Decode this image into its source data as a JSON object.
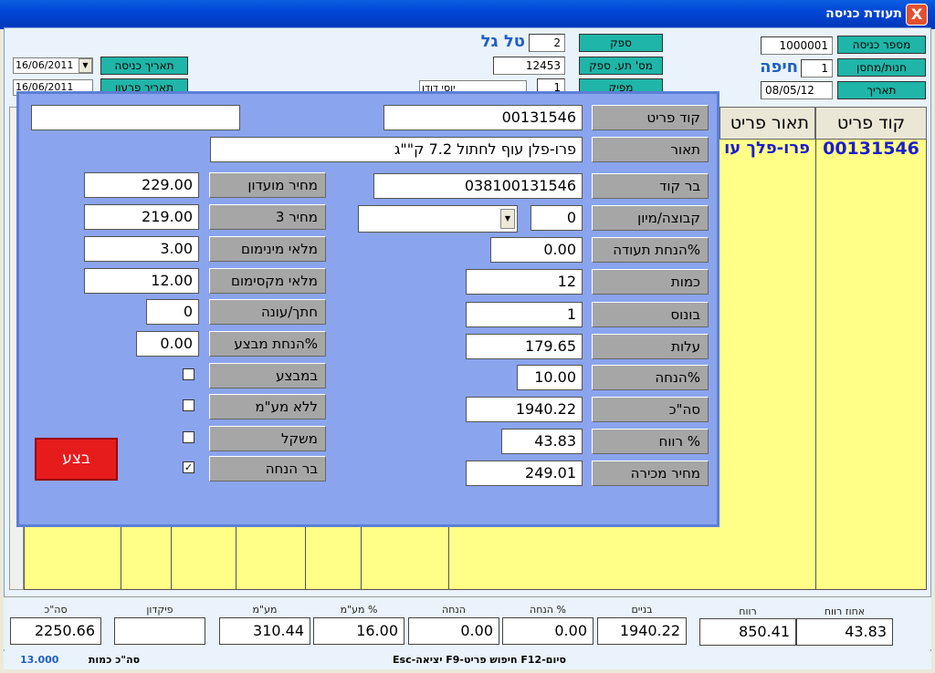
{
  "window": {
    "title": "תעודת כניסה",
    "close_glyph": "X"
  },
  "header": {
    "entry_number_label": "מספר כניסה",
    "entry_number": "1000001",
    "store_label": "חנות/מחסן",
    "store_code": "1",
    "store_name": "חיפה",
    "date_label": "תאריך",
    "date": "08/05/12",
    "supplier_label": "ספק",
    "supplier_code": "2",
    "supplier_name": "טל גל",
    "supplier_doc_label": "מס' תע. ספק",
    "supplier_doc": "12453",
    "dist_label": "מפיק",
    "dist_code": "1",
    "dist_name": "יוסי דודו",
    "entry_date_label": "תאריך כניסה",
    "entry_date": "16/06/2011",
    "pay_date_label": "תאריך פרעון",
    "pay_date": "16/06/2011"
  },
  "grid": {
    "col_code": "קוד פריט",
    "col_desc": "תאור פריט",
    "row_code": "00131546",
    "row_desc": "פרו-פלך עו"
  },
  "dialog": {
    "item_code_label": "קוד פריט",
    "item_code": "00131546",
    "extra_field": "",
    "desc_label": "תאור",
    "desc": "פרו-פלן עוף לחתול 7.2 ק\"\"ג",
    "barcode_label": "בר קוד",
    "barcode": "038100131546",
    "group_label": "קבוצה/מיון",
    "group": "0",
    "group_select": "",
    "doc_discount_label": "%הנחת תעודה",
    "doc_discount": "0.00",
    "qty_label": "כמות",
    "qty": "12",
    "bonus_label": "בונוס",
    "bonus": "1",
    "cost_label": "עלות",
    "cost": "179.65",
    "discount_label": "%הנחה",
    "discount": "10.00",
    "total_label": "סה\"כ",
    "total": "1940.22",
    "profit_label": "% רווח",
    "profit": "43.83",
    "sale_price_label": "מחיר מכירה",
    "sale_price": "249.01",
    "club_price_label": "מחיר מועדון",
    "club_price": "229.00",
    "price3_label": "מחיר 3",
    "price3": "219.00",
    "min_stock_label": "מלאי מינימום",
    "min_stock": "3.00",
    "max_stock_label": "מלאי מקסימום",
    "max_stock": "12.00",
    "size_label": "חתך/עונה",
    "size": "0",
    "promo_discount_label": "%הנחת מבצע",
    "promo_discount": "0.00",
    "on_sale_label": "במבצע",
    "no_vat_label": "ללא מע\"מ",
    "weight_label": "משקל",
    "bar_discount_label": "בר הנחה",
    "exec_label": "בצע",
    "check": "✓",
    "dd": "▼"
  },
  "footer": {
    "profit_pct_label": "אחוז רווח",
    "profit_pct": "43.83",
    "profit_label": "רווח",
    "profit": "850.41",
    "net_label": "בניים",
    "net": "1940.22",
    "disc_pct_label": "% הנחה",
    "disc_pct": "0.00",
    "disc_label": "הנחה",
    "disc": "0.00",
    "vat_pct_label": "% מע\"מ",
    "vat_pct": "16.00",
    "vat_label": "מע\"מ",
    "vat": "310.44",
    "deposit_label": "פיקדון",
    "deposit": "",
    "total_label": "סה\"כ",
    "total": "2250.66"
  },
  "status": {
    "hint": "Esc-יציאה F9-חיפוש פריט F12-סיום",
    "qty_total_label": "סה\"כ כמות",
    "qty_total": "13.000"
  }
}
